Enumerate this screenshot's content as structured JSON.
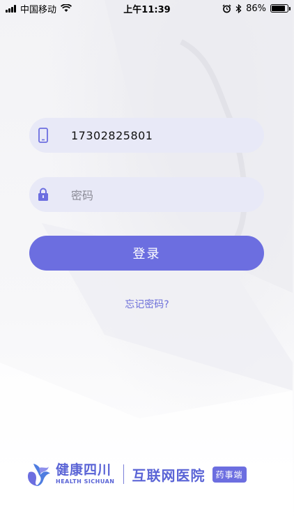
{
  "status_bar": {
    "carrier": "中国移动",
    "time": "上午11:39",
    "battery_percent": "86%",
    "battery_level": 0.86
  },
  "login": {
    "phone_value": "17302825801",
    "password_placeholder": "密码",
    "login_label": "登录",
    "forgot_label": "忘记密码?"
  },
  "footer": {
    "brand_cn": "健康四川",
    "brand_en": "HEALTH SICHUAN",
    "hospital": "互联网医院",
    "tag": "药事端"
  },
  "colors": {
    "accent": "#6c6ee0",
    "field_bg": "#e8e9f7",
    "brand": "#5a64d6"
  }
}
